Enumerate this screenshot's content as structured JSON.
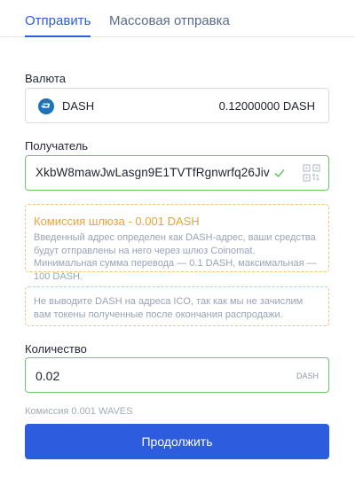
{
  "tabs": [
    {
      "label": "Отправить",
      "active": true
    },
    {
      "label": "Массовая отправка",
      "active": false
    }
  ],
  "currency": {
    "label": "Валюта",
    "name": "DASH",
    "balance": "0.12000000 DASH",
    "icon": "dash-logo-icon",
    "brand_color": "#1c75bc"
  },
  "recipient": {
    "label": "Получатель",
    "value": "XkbW8mawJwLasgn9E1TVTfRgnwrfq26Jiv",
    "valid": true
  },
  "gateway_notice": {
    "title": "Комиссия шлюза - 0.001 DASH",
    "text": "Введенный адрес определен как DASH-адрес, ваши средства будут отправлены на него через шлюз Coinomat. Минимальная сумма перевода — 0.1 DASH, максимальная — 100 DASH."
  },
  "ico_notice": {
    "text": "Не выводите DASH на адреса ICO, так как мы не зачислим вам токены полученные после окончания распродажи."
  },
  "amount": {
    "label": "Количество",
    "value": "0.02",
    "unit": "DASH"
  },
  "fee": "Комиссия 0.001 WAVES",
  "continue_label": "Продолжить",
  "colors": {
    "accent": "#2d5dde",
    "valid": "#6dc56a",
    "warning": "#e8a33a"
  }
}
